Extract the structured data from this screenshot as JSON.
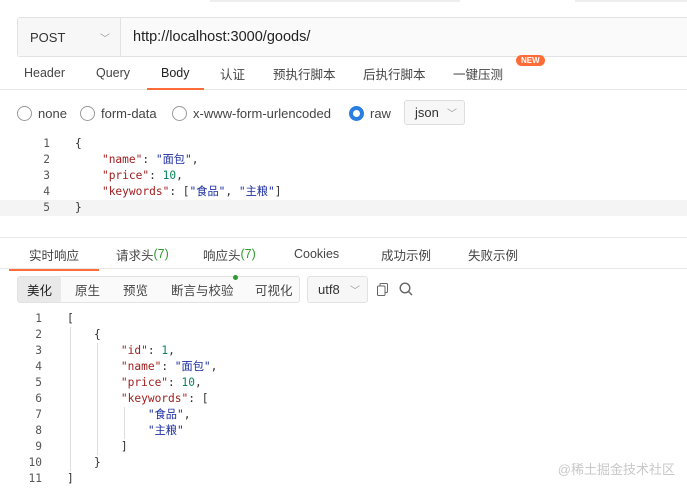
{
  "request": {
    "method": "POST",
    "url": "http://localhost:3000/goods/"
  },
  "request_tabs": [
    "Header",
    "Query",
    "Body",
    "认证",
    "预执行脚本",
    "后执行脚本",
    "一键压测"
  ],
  "new_badge": "NEW",
  "body_types": {
    "options": [
      "none",
      "form-data",
      "x-www-form-urlencoded",
      "raw"
    ],
    "selected": "raw",
    "format": "json"
  },
  "request_body": [
    {
      "n": "1",
      "t": "{"
    },
    {
      "n": "2",
      "t": "    \"name\": \"面包\","
    },
    {
      "n": "3",
      "t": "    \"price\": 10,"
    },
    {
      "n": "4",
      "t": "    \"keywords\": [\"食品\", \"主粮\"]"
    },
    {
      "n": "5",
      "t": "}"
    }
  ],
  "response_tabs": [
    {
      "label": "实时响应",
      "count": ""
    },
    {
      "label": "请求头",
      "count": "(7)"
    },
    {
      "label": "响应头",
      "count": "(7)"
    },
    {
      "label": "Cookies",
      "count": ""
    },
    {
      "label": "成功示例",
      "count": ""
    },
    {
      "label": "失败示例",
      "count": ""
    }
  ],
  "response_view": {
    "modes": [
      "美化",
      "原生",
      "预览",
      "断言与校验",
      "可视化"
    ],
    "active_mode": "美化",
    "encoding": "utf8"
  },
  "response_body": [
    {
      "n": "1",
      "t": "["
    },
    {
      "n": "2",
      "t": "    {"
    },
    {
      "n": "3",
      "t": "        \"id\": 1,"
    },
    {
      "n": "4",
      "t": "        \"name\": \"面包\","
    },
    {
      "n": "5",
      "t": "        \"price\": 10,"
    },
    {
      "n": "6",
      "t": "        \"keywords\": ["
    },
    {
      "n": "7",
      "t": "            \"食品\","
    },
    {
      "n": "8",
      "t": "            \"主粮\""
    },
    {
      "n": "9",
      "t": "        ]"
    },
    {
      "n": "10",
      "t": "    }"
    },
    {
      "n": "11",
      "t": "]"
    }
  ],
  "watermark": "@稀土掘金技术社区",
  "colors": {
    "accent": "#ff6c37",
    "radio": "#2a7de1",
    "count": "#2e9b2e"
  }
}
